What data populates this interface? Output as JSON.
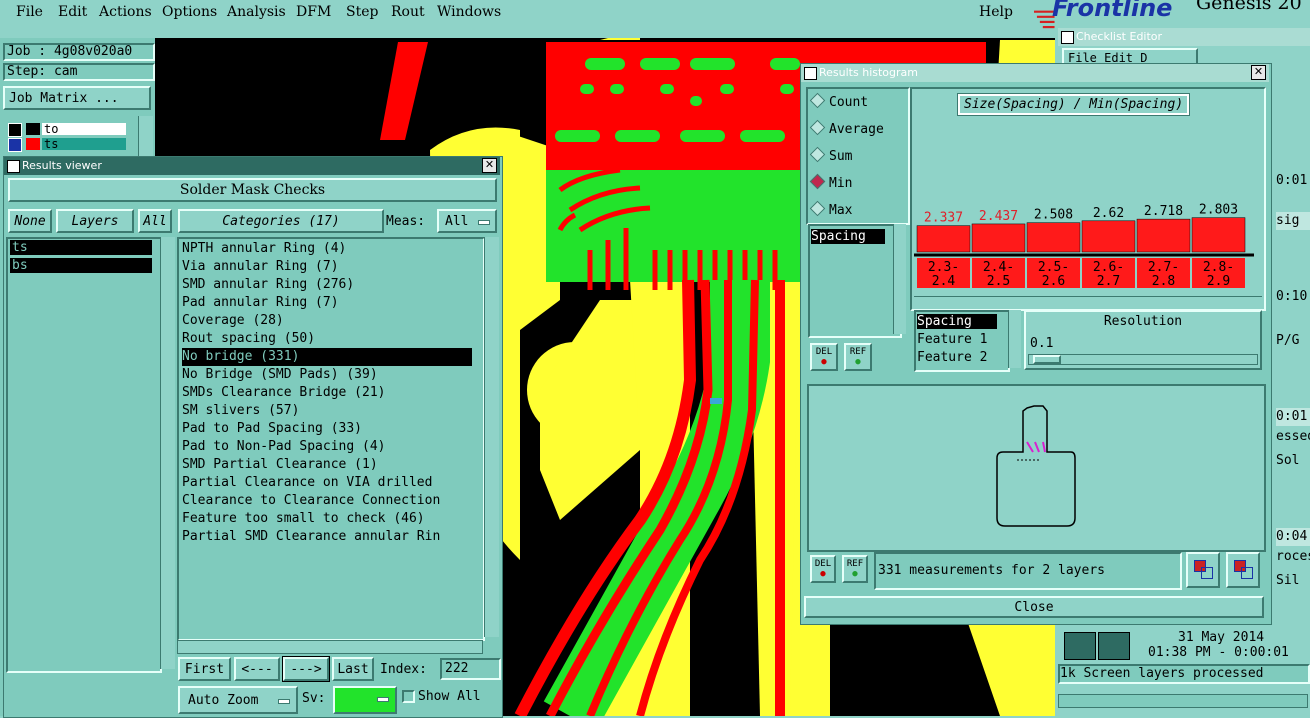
{
  "menu": {
    "items": [
      "File",
      "Edit",
      "Actions",
      "Options",
      "Analysis",
      "DFM",
      "Step",
      "Rout",
      "Windows"
    ],
    "help": "Help"
  },
  "brand": {
    "logo": "Frontline",
    "product": "Genesis 20"
  },
  "job_panel": {
    "job": "Job : 4g08v020a0",
    "step": "Step: cam",
    "matrix_button": "Job Matrix ...",
    "layers": [
      {
        "name": "to",
        "color": "#000000"
      },
      {
        "name": "ts",
        "color": "#ff0000"
      }
    ]
  },
  "results_viewer": {
    "title": "Results viewer",
    "heading": "Solder Mask Checks",
    "none_btn": "None",
    "layers_btn": "Layers",
    "all_btn": "All",
    "categories_btn": "Categories (17)",
    "meas_label": "Meas:",
    "meas_value": "All",
    "layer_list": [
      "ts",
      "bs"
    ],
    "categories": [
      "NPTH annular Ring (4)",
      "Via annular Ring (7)",
      "SMD annular Ring (276)",
      "Pad annular Ring (7)",
      "Coverage (28)",
      "Rout spacing (50)",
      "No bridge (331)",
      "No Bridge (SMD Pads) (39)",
      "SMDs Clearance Bridge (21)",
      "SM slivers (57)",
      "Pad to Pad Spacing (33)",
      "Pad to Non-Pad Spacing (4)",
      "SMD Partial Clearance (1)",
      "Partial Clearance on VIA drilled",
      "Clearance to Clearance Connection",
      "Feature too small to check (46)",
      "Partial SMD Clearance annular Rin"
    ],
    "selected_index": 6,
    "first_btn": "First",
    "prev_btn": "<---",
    "next_btn": "--->",
    "last_btn": "Last",
    "index_label": "Index:",
    "index_value": "222",
    "auto_zoom": "Auto Zoom",
    "sv_label": "Sv:",
    "show_all": "Show All"
  },
  "histogram": {
    "title": "Results histogram",
    "modes": [
      "Count",
      "Average",
      "Sum",
      "Min",
      "Max"
    ],
    "selected_mode": "Min",
    "chart_title": "Size(Spacing) / Min(Spacing)",
    "list_item": "Spacing",
    "del_btn": "DEL",
    "ref_btn": "REF",
    "fields": [
      "Spacing",
      "Feature 1",
      "Feature 2"
    ],
    "resolution_label": "Resolution",
    "resolution_value": "0.1",
    "summary": "331 measurements for 2 layers",
    "close_btn": "Close"
  },
  "chart_data": {
    "type": "bar",
    "title": "Size(Spacing) / Min(Spacing)",
    "categories": [
      "2.3-2.4",
      "2.4-2.5",
      "2.5-2.6",
      "2.6-2.7",
      "2.7-2.8",
      "2.8-2.9"
    ],
    "values": [
      2.337,
      2.437,
      2.508,
      2.62,
      2.718,
      2.803
    ],
    "value_labels": [
      "2.337",
      "2.437",
      "2.508",
      "2.62",
      "2.718",
      "2.803"
    ],
    "label_colors": [
      "#e0202a",
      "#e0202a",
      "#000000",
      "#000000",
      "#000000",
      "#000000"
    ],
    "bar_color": "#ff1a1a"
  },
  "checklist": {
    "title": "Checklist Editor",
    "menu": "File  Edit  D",
    "row_labels": [
      "0:01",
      "sig",
      "0:10",
      "P/G",
      "0:01",
      "essed",
      "Sol",
      "0:04",
      "roces",
      "Sil"
    ],
    "date": "31 May 2014",
    "time": "01:38 PM - 0:00:01",
    "status": "1k Screen layers processed"
  },
  "colors": {
    "bg": "#8fd3c8",
    "trace_red": "#ff0000",
    "trace_green": "#22e32b",
    "copper_yellow": "#ffff33"
  }
}
